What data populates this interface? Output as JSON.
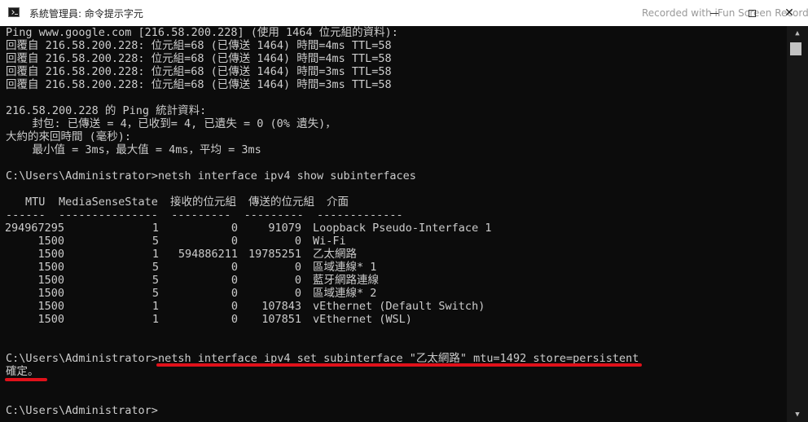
{
  "window": {
    "title": "系統管理員: 命令提示字元",
    "watermark": "Recorded with iFun Screen Recorder",
    "minimize_glyph": "",
    "maximize_glyph": "",
    "close_glyph": "✕"
  },
  "scrollbar": {
    "up_glyph": "▲",
    "down_glyph": "▼"
  },
  "console": {
    "ping_header": "Ping www.google.com [216.58.200.228] (使用 1464 位元組的資料):",
    "replies": [
      "回覆自 216.58.200.228: 位元組=68 (已傳送 1464) 時間=4ms TTL=58",
      "回覆自 216.58.200.228: 位元組=68 (已傳送 1464) 時間=4ms TTL=58",
      "回覆自 216.58.200.228: 位元組=68 (已傳送 1464) 時間=3ms TTL=58",
      "回覆自 216.58.200.228: 位元組=68 (已傳送 1464) 時間=3ms TTL=58"
    ],
    "stats": [
      "216.58.200.228 的 Ping 統計資料:",
      "    封包: 已傳送 = 4，已收到= 4, 已遺失 = 0 (0% 遺失)，",
      "大約的來回時間 (毫秒):",
      "    最小值 = 3ms，最大值 = 4ms，平均 = 3ms"
    ],
    "prompt": "C:\\Users\\Administrator>",
    "cmd_show": "netsh interface ipv4 show subinterfaces",
    "table_headers": {
      "mtu": "MTU",
      "mss": "MediaSenseState",
      "recv": "接收的位元組",
      "sent": "傳送的位元組",
      "iface": "介面"
    },
    "table_separator": "------  ---------------  ---------  ---------  -------------",
    "table_rows": [
      {
        "mtu": "4294967295",
        "mss": "1",
        "recv": "0",
        "sent": "91079",
        "iface": "Loopback Pseudo-Interface 1"
      },
      {
        "mtu": "1500",
        "mss": "5",
        "recv": "0",
        "sent": "0",
        "iface": "Wi-Fi"
      },
      {
        "mtu": "1500",
        "mss": "1",
        "recv": "594886211",
        "sent": "19785251",
        "iface": "乙太網路"
      },
      {
        "mtu": "1500",
        "mss": "5",
        "recv": "0",
        "sent": "0",
        "iface": "區域連線* 1"
      },
      {
        "mtu": "1500",
        "mss": "5",
        "recv": "0",
        "sent": "0",
        "iface": "藍牙網路連線"
      },
      {
        "mtu": "1500",
        "mss": "5",
        "recv": "0",
        "sent": "0",
        "iface": "區域連線* 2"
      },
      {
        "mtu": "1500",
        "mss": "1",
        "recv": "0",
        "sent": "107843",
        "iface": "vEthernet (Default Switch)"
      },
      {
        "mtu": "1500",
        "mss": "1",
        "recv": "0",
        "sent": "107851",
        "iface": "vEthernet (WSL)"
      }
    ],
    "cmd_set": "netsh interface ipv4 set subinterface \"乙太網路\" mtu=1492 store=persistent",
    "result": "確定。",
    "final_prompt": "C:\\Users\\Administrator>"
  },
  "annotation_color": "#e0111a"
}
